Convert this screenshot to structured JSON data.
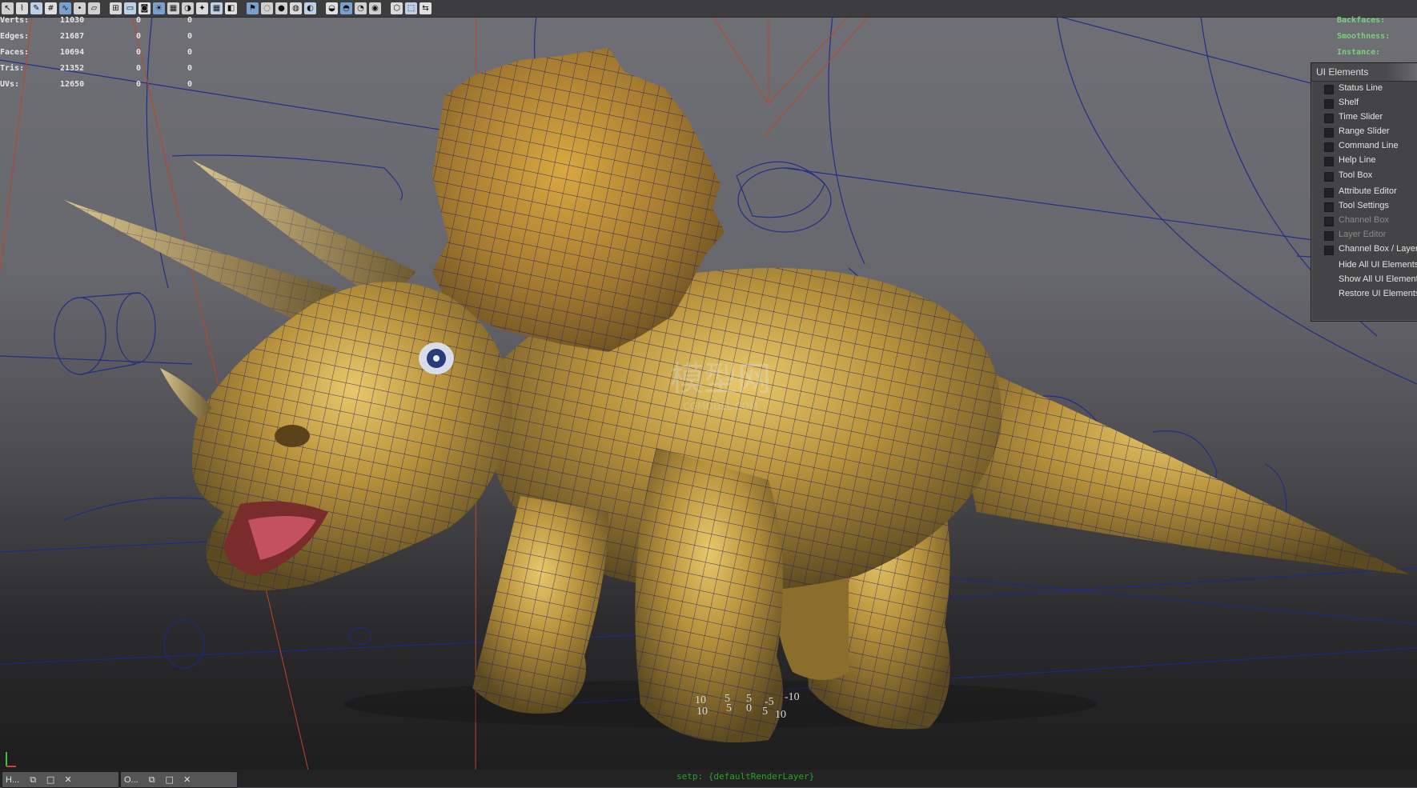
{
  "toolbar": {
    "icons": [
      "select-icon",
      "lasso-icon",
      "paint-icon",
      "snap-grid-icon",
      "snap-curve-icon",
      "snap-point-icon",
      "snap-plane-icon",
      "wireframe-icon",
      "film-gate-icon",
      "camera-icon",
      "lighting-icon",
      "texture-icon",
      "shadow-icon",
      "xray-icon",
      "grid-toggle-icon",
      "isolate-icon",
      "bookmark-icon",
      "smooth-icon",
      "default-light-icon",
      "all-lights-icon",
      "sphere-icon",
      "shaded-icon",
      "textured-icon",
      "hardware-icon",
      "highlight-icon",
      "cube-icon",
      "frame-icon",
      "share-icon"
    ]
  },
  "hud": {
    "rows": [
      {
        "label": "Verts:",
        "v1": "11030",
        "v2": "0",
        "v3": "0"
      },
      {
        "label": "Edges:",
        "v1": "21687",
        "v2": "0",
        "v3": "0"
      },
      {
        "label": "Faces:",
        "v1": "10694",
        "v2": "0",
        "v3": "0"
      },
      {
        "label": "Tris:",
        "v1": "21352",
        "v2": "0",
        "v3": "0"
      },
      {
        "label": "UVs:",
        "v1": "12650",
        "v2": "0",
        "v3": "0"
      }
    ],
    "right": [
      "Backfaces:",
      "Smoothness:",
      "Instance:"
    ]
  },
  "ui_elements_menu": {
    "title": "UI Elements",
    "items": [
      {
        "label": "Status Line",
        "checkbox": true,
        "enabled": true
      },
      {
        "label": "Shelf",
        "checkbox": true,
        "enabled": true
      },
      {
        "label": "Time Slider",
        "checkbox": true,
        "enabled": true
      },
      {
        "label": "Range Slider",
        "checkbox": true,
        "enabled": true
      },
      {
        "label": "Command Line",
        "checkbox": true,
        "enabled": true
      },
      {
        "label": "Help Line",
        "checkbox": true,
        "enabled": true
      },
      {
        "label": "Tool Box",
        "checkbox": true,
        "enabled": true
      },
      {
        "label": "Attribute Editor",
        "checkbox": true,
        "enabled": true
      },
      {
        "label": "Tool Settings",
        "checkbox": true,
        "enabled": true
      },
      {
        "label": "Channel Box",
        "checkbox": true,
        "enabled": false
      },
      {
        "label": "Layer Editor",
        "checkbox": true,
        "enabled": false
      },
      {
        "label": "Channel Box / Layer",
        "checkbox": true,
        "enabled": true
      },
      {
        "label": "Hide All UI Elements",
        "checkbox": false,
        "enabled": true
      },
      {
        "label": "Show All UI Elements",
        "checkbox": false,
        "enabled": true
      },
      {
        "label": "Restore UI Elements",
        "checkbox": false,
        "enabled": true
      }
    ]
  },
  "grid_numbers": [
    "-10",
    "5",
    "10",
    "5",
    "0",
    "5",
    "-5",
    "10",
    "5",
    "10"
  ],
  "watermark": {
    "glyph": "模型网",
    "text": "CGMODEL.COM"
  },
  "bottom_bar": {
    "tabs": [
      {
        "label": "H...",
        "icon": "window-icon"
      },
      {
        "label": "O...",
        "icon": "outliner-icon"
      }
    ],
    "tab_buttons": [
      "⧉",
      "□",
      "✕"
    ],
    "feedback": "setp: {defaultRenderLayer}"
  },
  "colors": {
    "model_base": "#b08c3a",
    "wire": "#1a1a6e",
    "accent_red": "#c0452a",
    "hud_green": "#7bd07b"
  }
}
